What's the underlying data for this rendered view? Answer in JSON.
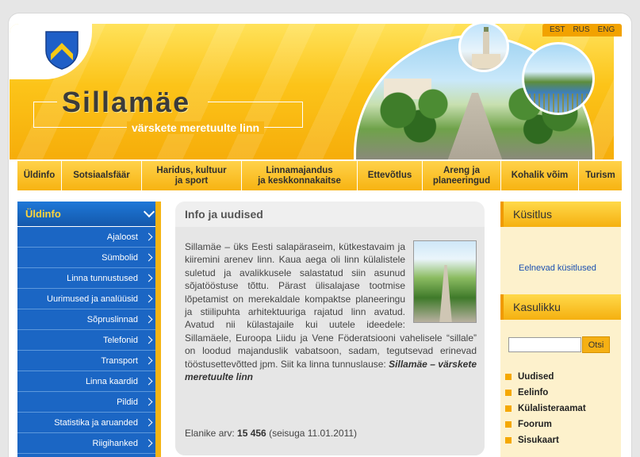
{
  "header": {
    "site_title": "Sillamäe",
    "tagline": "värskete meretuulte linn",
    "languages": [
      "EST",
      "RUS",
      "ENG"
    ],
    "images": [
      "shield-icon",
      "alley-photo",
      "town-hall-tower-photo",
      "lake-photo"
    ]
  },
  "topnav": {
    "items": [
      {
        "label": "Üldinfo"
      },
      {
        "label": "Sotsiaalsfäär"
      },
      {
        "label": "Haridus, kultuur\nja sport"
      },
      {
        "label": "Linnamajandus\nja keskkonnakaitse"
      },
      {
        "label": "Ettevõtlus"
      },
      {
        "label": "Areng ja\nplaneeringud"
      },
      {
        "label": "Kohalik võim"
      },
      {
        "label": "Turism"
      }
    ]
  },
  "leftnav": {
    "title": "Üldinfo",
    "items": [
      {
        "label": "Ajaloost"
      },
      {
        "label": "Sümbolid"
      },
      {
        "label": "Linna tunnustused"
      },
      {
        "label": "Uurimused ja analüüsid"
      },
      {
        "label": "Sõpruslinnad"
      },
      {
        "label": "Telefonid"
      },
      {
        "label": "Transport"
      },
      {
        "label": "Linna kaardid"
      },
      {
        "label": "Pildid"
      },
      {
        "label": "Statistika ja aruanded"
      },
      {
        "label": "Riigihanked"
      }
    ]
  },
  "main": {
    "title": "Info ja uudised",
    "body": "Sillamäe – üks Eesti salapäraseim, kütkestavaim ja kiiremini arenev linn. Kaua aega oli linn külalistele suletud ja avalikkusele salastatud siin asunud sõjatööstuse tõttu. Pärast ülisalajase tootmise lõpetamist on merekaldale kompaktse planeeringu ja stiilipuhta arhitektuuriga rajatud linn avatud. Avatud nii külastajaile kui uutele ideedele: Sillamäele, Euroopa Liidu ja Vene Föderatsiooni vahelisele “sillale” on loodud majanduslik vabatsoon, sadam, tegutsevad erinevad tööstusettevõtted jpm. Siit ka linna tunnuslause: ",
    "motto": "Sillamäe – värskete meretuulte linn",
    "population_label": "Elanike arv: ",
    "population_value": "15 456",
    "population_date": " (seisuga 11.01.2011)"
  },
  "right": {
    "poll_title": "Küsitlus",
    "poll_link": "Eelnevad küsitlused",
    "useful_title": "Kasulikku",
    "search_button": "Otsi",
    "search_value": "",
    "links": [
      {
        "label": "Uudised"
      },
      {
        "label": "Eelinfo"
      },
      {
        "label": "Külalisteraamat"
      },
      {
        "label": "Foorum"
      },
      {
        "label": "Sisukaart"
      }
    ]
  },
  "colors": {
    "accent_yellow": "#f7b312",
    "nav_blue": "#1b66c4",
    "title_gold": "#ffd43c"
  }
}
